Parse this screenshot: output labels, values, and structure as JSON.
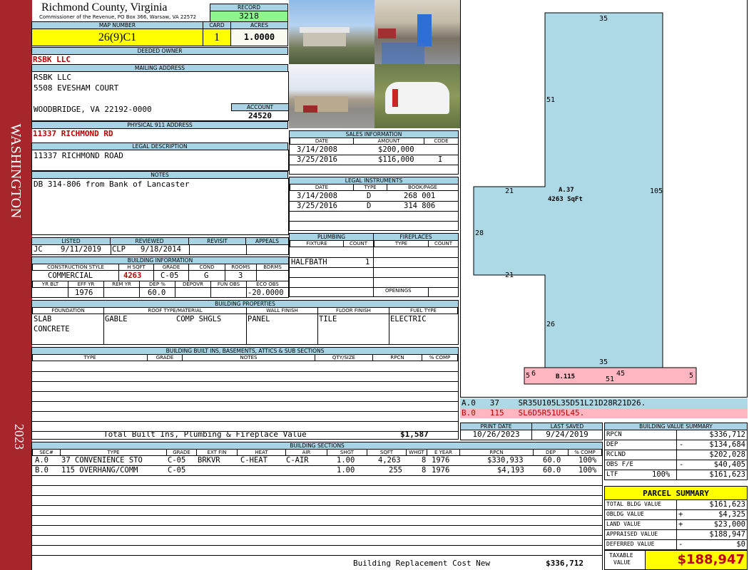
{
  "sidebar": {
    "label": "WASHINGTON",
    "year": "2023"
  },
  "header": {
    "county": "Richmond County, Virginia",
    "address_line": "Commissioner of the Revenue, PO Box 366, Warsaw, VA 22572"
  },
  "record": {
    "label": "RECORD",
    "value": "3218"
  },
  "map": {
    "label": "MAP NUMBER",
    "value": "26(9)C1"
  },
  "card": {
    "label": "CARD",
    "value": "1"
  },
  "acres": {
    "label": "ACRES",
    "value": "1.0000"
  },
  "deeded_owner": {
    "label": "DEEDED OWNER",
    "value": "RSBK LLC"
  },
  "mailing": {
    "label": "MAILING ADDRESS",
    "line1": "RSBK LLC",
    "line2": "5508 EVESHAM COURT",
    "line3": "WOODBRIDGE, VA 22192-0000"
  },
  "account": {
    "label": "ACCOUNT",
    "value": "24520"
  },
  "physical": {
    "label": "PHYSICAL 911 ADDRESS",
    "value": "11337 RICHMOND RD"
  },
  "legal_desc": {
    "label": "LEGAL DESCRIPTION",
    "value": "11337 RICHMOND ROAD"
  },
  "notes": {
    "label": "NOTES",
    "value": "DB 314-806 from Bank of Lancaster"
  },
  "sales": {
    "label": "SALES INFORMATION",
    "headers": {
      "date": "DATE",
      "amount": "AMOUNT",
      "code": "CODE"
    },
    "rows": [
      {
        "date": "3/14/2008",
        "amount": "$200,000",
        "code": ""
      },
      {
        "date": "3/25/2016",
        "amount": "$116,000",
        "code": "I"
      }
    ]
  },
  "legal_instruments": {
    "label": "LEGAL INSTRUMENTS",
    "headers": {
      "date": "DATE",
      "type": "TYPE",
      "bookpage": "BOOK/PAGE"
    },
    "rows": [
      {
        "date": "3/14/2008",
        "type": "D",
        "bookpage": "268 001"
      },
      {
        "date": "3/25/2016",
        "type": "D",
        "bookpage": "314 806"
      }
    ]
  },
  "plumbing": {
    "label": "PLUMBING",
    "h_fixture": "FIXTURE",
    "h_count": "COUNT",
    "fixture": "HALFBATH",
    "count": "1"
  },
  "fireplaces": {
    "label": "FIREPLACES",
    "h_type": "TYPE",
    "h_count": "COUNT",
    "openings": "OPENINGS"
  },
  "listed": {
    "h_listed": "LISTED",
    "h_reviewed": "REVIEWED",
    "h_revisit": "REVISIT",
    "h_appeals": "APPEALS",
    "listed_by": "JC",
    "listed_date": "9/11/2019",
    "reviewed_by": "CLP",
    "reviewed_date": "9/18/2014"
  },
  "building_info": {
    "label": "BUILDING INFORMATION",
    "h_style": "CONSTRUCTION STYLE",
    "h_hsqft": "H SQFT",
    "h_grade": "GRADE",
    "h_cond": "COND",
    "h_rooms": "ROOMS",
    "h_bdrms": "BDRMS",
    "style": "COMMERCIAL",
    "hsqft": "4263",
    "grade": "C-05",
    "cond": "G",
    "rooms": "3",
    "h_yrblt": "YR BLT",
    "h_effyr": "EFF YR",
    "h_remyr": "REM YR",
    "h_dep": "DEP %",
    "h_depovr": "DEPOVR",
    "h_funobs": "FUN OBS",
    "h_ecoobs": "ECO OBS",
    "effyr": "1976",
    "dep": "60.0",
    "ecoobs": "-20.0000"
  },
  "building_props": {
    "label": "BUILDING PROPERTIES",
    "h_foundation": "FOUNDATION",
    "h_roof": "ROOF TYPE/MATERIAL",
    "h_wall": "WALL FINISH",
    "h_floor": "FLOOR FINISH",
    "h_fuel": "FUEL TYPE",
    "foundation1": "SLAB",
    "foundation2": "CONCRETE",
    "roof_type": "GABLE",
    "roof_material": "COMP SHGLS",
    "wall": "PANEL",
    "floor": "TILE",
    "fuel": "ELECTRIC"
  },
  "built_ins": {
    "label": "BUILDING BUILT INS, BASEMENTS, ATTICS & SUB SECTIONS",
    "h_type": "TYPE",
    "h_grade": "GRADE",
    "h_notes": "NOTES",
    "h_qty": "QTY/SIZE",
    "h_rpcn": "RPCN",
    "h_comp": "% COMP",
    "total_label": "Total Built Ins, Plumbing & Fireplace Value",
    "total_value": "$1,587"
  },
  "sections": {
    "label": "BUILDING SECTIONS",
    "headers": {
      "sec": "SEC#",
      "type": "TYPE",
      "grade": "GRADE",
      "extfin": "EXT FIN",
      "heat": "HEAT",
      "air": "AIR",
      "shgt": "SHGT",
      "sqft": "SQFT",
      "whgt": "WHGT",
      "eyear": "E YEAR",
      "rpcn": "RPCN",
      "dep": "DEP",
      "comp": "% COMP"
    },
    "rows": [
      {
        "sec": "A.0",
        "type": "37 CONVENIENCE STO",
        "grade": "C-05",
        "extfin": "BRKVR",
        "heat": "C-HEAT",
        "air": "C-AIR",
        "shgt": "1.00",
        "sqft": "4,263",
        "whgt": "8",
        "eyear": "1976",
        "rpcn": "$330,933",
        "dep": "60.0",
        "comp": "100%"
      },
      {
        "sec": "B.0",
        "type": "115 OVERHANG/COMM",
        "grade": "C-05",
        "extfin": "",
        "heat": "",
        "air": "",
        "shgt": "1.00",
        "sqft": "255",
        "whgt": "8",
        "eyear": "1976",
        "rpcn": "$4,193",
        "dep": "60.0",
        "comp": "100%"
      }
    ],
    "total_label": "Building Replacement Cost New",
    "total_value": "$336,712"
  },
  "sketch": {
    "dims": {
      "top": "35",
      "left_upper": "51",
      "notch_top": "21",
      "right": "105",
      "notch_side": "28",
      "notch_bottom": "21",
      "left_lower": "26",
      "bottom": "35"
    },
    "label_a": "A.37",
    "label_a_area": "4263 SqFt",
    "label_b": "B.115",
    "b_dims": {
      "left": "5",
      "inner": "6",
      "bottom": "51",
      "top": "45",
      "right": "5"
    },
    "code_a": "A.0   37    SR35U105L35D51L21D28R21D26.",
    "code_b": "B.0   115   SL6D5R51U5L45."
  },
  "print": {
    "h_print": "PRINT DATE",
    "h_saved": "LAST SAVED",
    "print_date": "10/26/2023",
    "last_saved": "9/24/2019"
  },
  "value_summary": {
    "label": "BUILDING VALUE SUMMARY",
    "rows": [
      {
        "label": "RPCN",
        "sign": "",
        "extra": "",
        "value": "$336,712"
      },
      {
        "label": "DEP",
        "sign": "-",
        "extra": "",
        "value": "$134,684"
      },
      {
        "label": "RCLND",
        "sign": "",
        "extra": "",
        "value": "$202,028"
      },
      {
        "label": "OBS F/E",
        "sign": "-",
        "extra": "",
        "value": "$40,405"
      },
      {
        "label": "LTF",
        "sign": "",
        "extra": "100%",
        "value": "$161,623"
      }
    ]
  },
  "parcel_summary": {
    "label": "PARCEL SUMMARY",
    "rows": [
      {
        "label": "TOTAL BLDG VALUE",
        "sign": "",
        "value": "$161,623"
      },
      {
        "label": "OBLDG VALUE",
        "sign": "+",
        "value": "$4,325"
      },
      {
        "label": "LAND VALUE",
        "sign": "+",
        "value": "$23,000"
      },
      {
        "label": "APPRAISED VALUE",
        "sign": "",
        "value": "$188,947"
      },
      {
        "label": "DEFERRED VALUE",
        "sign": "-",
        "value": "$0"
      }
    ],
    "taxable_label1": "TAXABLE",
    "taxable_label2": "VALUE",
    "taxable_value": "$188,947"
  },
  "colors": {
    "sidebar": "#a6262c",
    "header_blue": "#a8d3e4",
    "highlight_yellow": "#ffff00",
    "record_green": "#8ef58e",
    "sketch_blue": "#add8e6",
    "sketch_pink": "#ffb6c1",
    "value_red": "#c00000"
  }
}
